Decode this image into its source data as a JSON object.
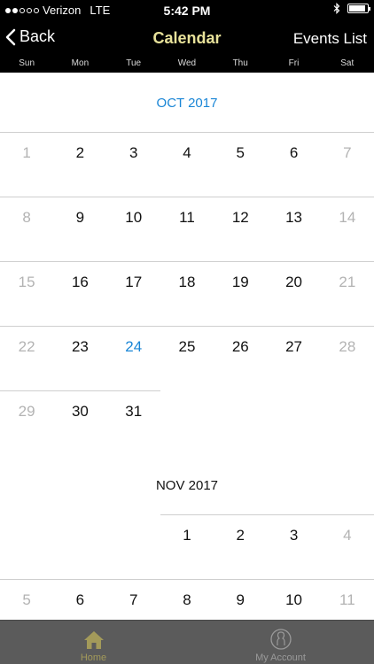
{
  "status": {
    "carrier": "Verizon",
    "network": "LTE",
    "time": "5:42 PM",
    "signal_dots": [
      true,
      true,
      false,
      false,
      false
    ],
    "battery_level": 0.9
  },
  "nav": {
    "back_label": "Back",
    "title": "Calendar",
    "right_label": "Events List"
  },
  "weekdays": [
    "Sun",
    "Mon",
    "Tue",
    "Wed",
    "Thu",
    "Fri",
    "Sat"
  ],
  "months": [
    {
      "title": "OCT 2017",
      "highlight_title": true,
      "weeks": [
        [
          1,
          2,
          3,
          4,
          5,
          6,
          7
        ],
        [
          8,
          9,
          10,
          11,
          12,
          13,
          14
        ],
        [
          15,
          16,
          17,
          18,
          19,
          20,
          21
        ],
        [
          22,
          23,
          24,
          25,
          26,
          27,
          28
        ],
        [
          29,
          30,
          31,
          null,
          null,
          null,
          null
        ]
      ],
      "today": 24
    },
    {
      "title": "NOV 2017",
      "highlight_title": false,
      "weeks": [
        [
          null,
          null,
          null,
          1,
          2,
          3,
          4
        ],
        [
          5,
          6,
          7,
          8,
          9,
          10,
          11
        ]
      ],
      "today": null
    }
  ],
  "colors": {
    "accent": "#1a86d6",
    "nav_title": "#e8e29a",
    "tab_active": "#a39a5a",
    "weekend": "#b3b3b3"
  },
  "tabs": [
    {
      "label": "Home",
      "icon": "home-icon",
      "active": true
    },
    {
      "label": "My Account",
      "icon": "account-icon",
      "active": false
    }
  ]
}
